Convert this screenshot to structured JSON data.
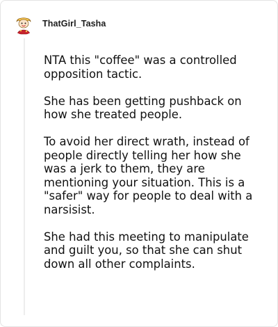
{
  "comment": {
    "author": {
      "username": "ThatGirl_Tasha",
      "avatar_icon": "cartoon-character-avatar-icon"
    },
    "paragraphs": [
      "NTA this \"coffee\" was a controlled opposition tactic.",
      "She has been getting pushback on how she treated people.",
      "To avoid her direct wrath, instead of people directly telling her how she was a jerk to them, they are mentioning your situation. This is a \"safer\" way for people to deal with a narsisist.",
      "She had this meeting to manipulate and guilt you, so that she can shut down all other complaints."
    ]
  },
  "colors": {
    "border": "#e3e3e3",
    "thread_line": "#ededed",
    "text": "#111111",
    "avatar_red": "#c8232c",
    "avatar_yellow": "#f2c14e"
  }
}
